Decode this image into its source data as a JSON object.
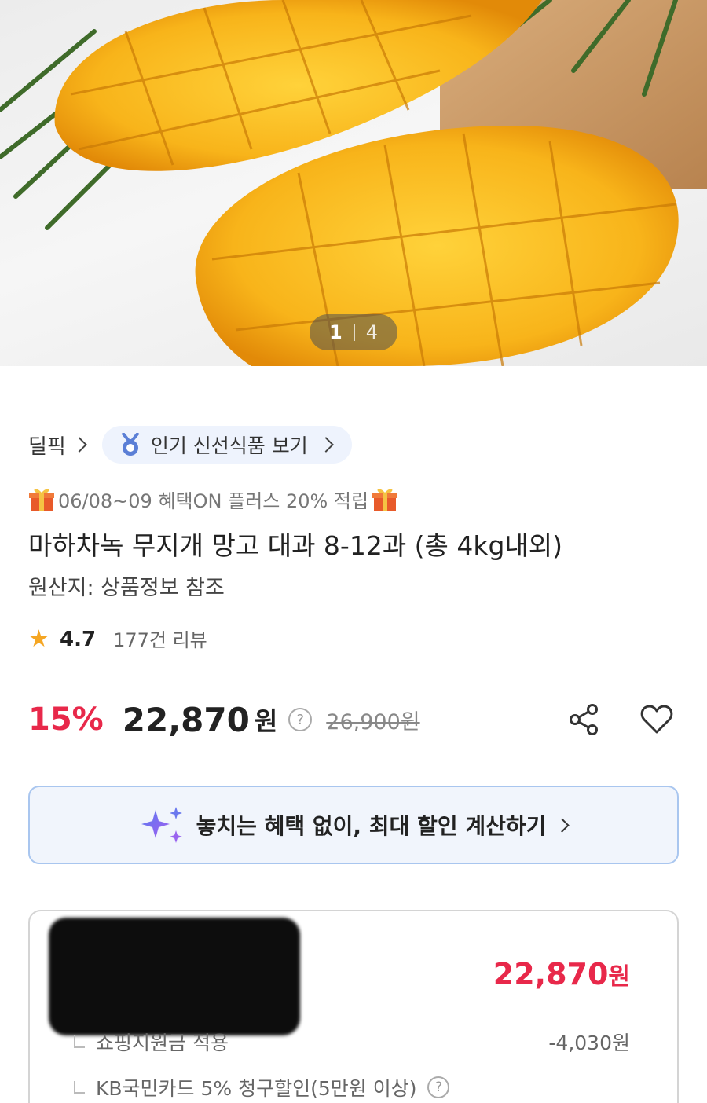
{
  "hero": {
    "pager_current": "1",
    "pager_total": "4"
  },
  "breadcrumb": {
    "dealpick_label": "딜픽",
    "popular_label": "인기 신선식품 보기"
  },
  "product": {
    "promo_text": "06/08~09 혜택ON 플러스 20% 적립",
    "title": "마하차녹 무지개 망고 대과 8-12과 (총 4kg내외)",
    "origin": "원산지: 상품정보 참조",
    "rating": "4.7",
    "review_count": "177건 리뷰"
  },
  "price": {
    "discount_rate": "15%",
    "sale_price": "22,870",
    "currency": "원",
    "original_price": "26,900원",
    "help_icon": "?"
  },
  "calc_banner": {
    "label": "놓치는 혜택 없이, 최대 할인 계산하기"
  },
  "breakdown": {
    "total_price": "22,870",
    "currency": "원",
    "items": [
      {
        "label": "쇼핑지원금 적용",
        "amount": "-4,030원"
      },
      {
        "label": "KB국민카드 5% 청구할인(5만원 이상)",
        "help": "?"
      }
    ]
  },
  "icons": {
    "share": "share-icon",
    "favorite": "heart-icon",
    "star": "star-icon",
    "gift": "gift-icon",
    "medal": "medal-icon",
    "sparkle": "sparkle-icon"
  },
  "colors": {
    "accent_red": "#e8284a",
    "star_orange": "#f5a623",
    "banner_border": "#a9c6ef",
    "pill_bg": "#eef3fd"
  }
}
